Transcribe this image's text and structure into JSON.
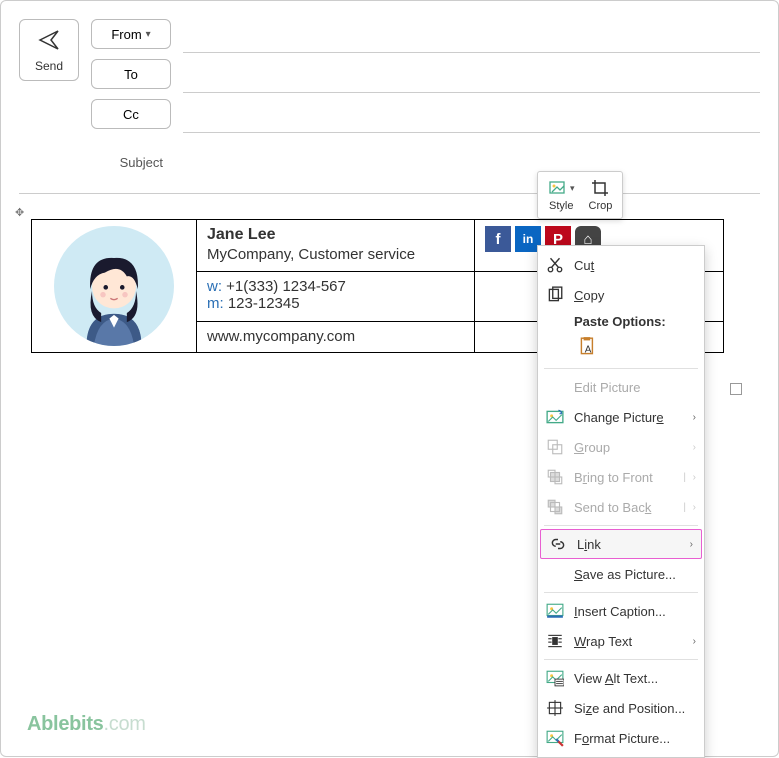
{
  "header": {
    "send_label": "Send",
    "from_label": "From",
    "to_label": "To",
    "cc_label": "Cc",
    "subject_label": "Subject"
  },
  "mini_toolbar": {
    "style_label": "Style",
    "crop_label": "Crop"
  },
  "signature": {
    "name": "Jane Lee",
    "company": "MyCompany, Customer service",
    "w_label": "w:",
    "w_value": "+1(333) 1234-567",
    "m_label": "m:",
    "m_value": "123-12345",
    "website": "www.mycompany.com",
    "social": {
      "facebook": "f",
      "linkedin": "in",
      "pinterest": "P",
      "instagram": "⌂"
    }
  },
  "context_menu": {
    "cut": "Cut",
    "copy": "Copy",
    "paste_options": "Paste Options:",
    "edit_picture": "Edit Picture",
    "change_picture": "Change Picture",
    "group": "Group",
    "bring_front": "Bring to Front",
    "send_back": "Send to Back",
    "link": "Link",
    "save_as_picture": "Save as Picture...",
    "insert_caption": "Insert Caption...",
    "wrap_text": "Wrap Text",
    "view_alt_text": "View Alt Text...",
    "size_position": "Size and Position...",
    "format_picture": "Format Picture..."
  },
  "watermark": {
    "brand": "Ablebits",
    "suffix": ".com"
  }
}
